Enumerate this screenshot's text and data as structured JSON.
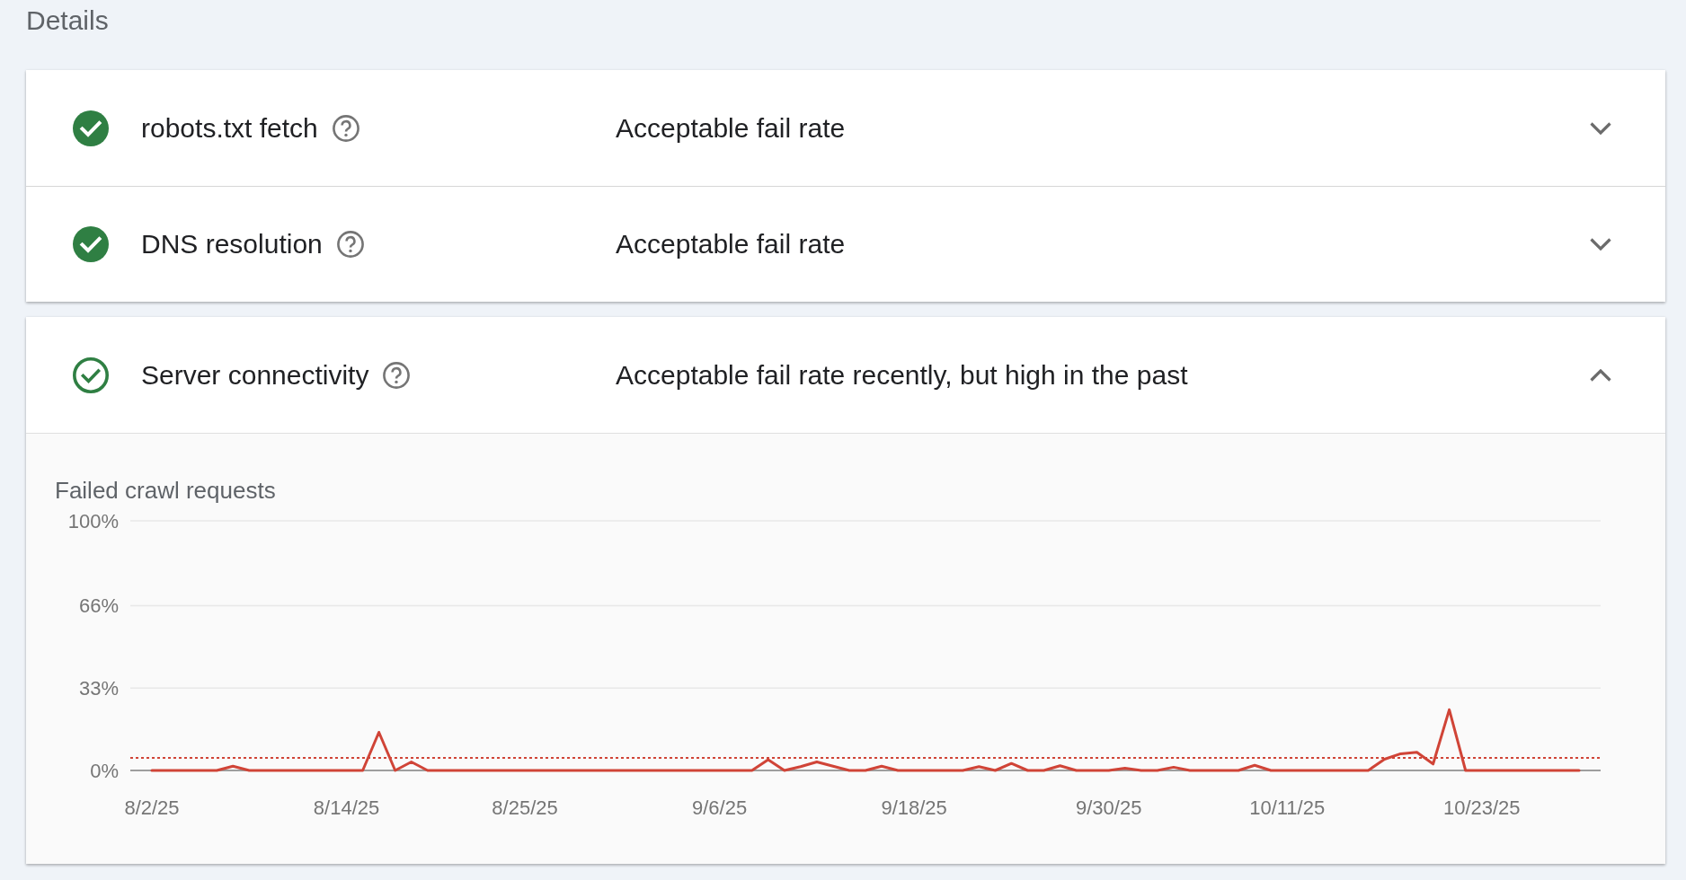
{
  "heading": "Details",
  "rows": [
    {
      "label": "robots.txt fetch",
      "status": "Acceptable fail rate",
      "kind": "filled",
      "expanded": false
    },
    {
      "label": "DNS resolution",
      "status": "Acceptable fail rate",
      "kind": "filled",
      "expanded": false
    },
    {
      "label": "Server connectivity",
      "status": "Acceptable fail rate recently, but high in the past",
      "kind": "outlined",
      "expanded": true,
      "chart_data": {
        "type": "line",
        "title": "Failed crawl requests",
        "categories": [
          "8/2/25",
          null,
          null,
          null,
          null,
          null,
          null,
          null,
          null,
          null,
          null,
          null,
          "8/14/25",
          null,
          null,
          null,
          null,
          null,
          null,
          null,
          null,
          null,
          null,
          "8/25/25",
          null,
          null,
          null,
          null,
          null,
          null,
          null,
          null,
          null,
          null,
          null,
          "9/6/25",
          null,
          null,
          null,
          null,
          null,
          null,
          null,
          null,
          null,
          null,
          null,
          "9/18/25",
          null,
          null,
          null,
          null,
          null,
          null,
          null,
          null,
          null,
          null,
          null,
          "9/30/25",
          null,
          null,
          null,
          null,
          null,
          null,
          null,
          null,
          null,
          null,
          "10/11/25",
          null,
          null,
          null,
          null,
          null,
          null,
          null,
          null,
          null,
          null,
          null,
          "10/23/25",
          null,
          null,
          null,
          null,
          null,
          null
        ],
        "series": [
          {
            "color": "#d04437",
            "values": [
              0,
              0,
              0,
              0,
              0,
              1.7,
              0,
              0,
              0,
              0,
              0,
              0,
              0,
              0,
              15.3,
              0,
              3.4,
              0,
              0,
              0,
              0,
              0,
              0,
              0,
              0,
              0,
              0,
              0,
              0,
              0,
              0,
              0,
              0,
              0,
              0,
              0,
              0,
              0,
              4.3,
              0,
              1.5,
              3.4,
              1.7,
              0,
              0,
              1.7,
              0,
              0,
              0,
              0,
              0,
              1.5,
              0,
              2.8,
              0,
              0,
              1.9,
              0,
              0,
              0,
              0.9,
              0,
              0,
              1.3,
              0,
              0,
              0,
              0,
              2.1,
              0,
              0,
              0,
              0,
              0,
              0,
              0,
              4.5,
              6.7,
              7.3,
              2.6,
              24.3,
              0,
              0,
              0,
              0,
              0,
              0,
              0,
              0
            ]
          }
        ],
        "ylim": [
          0,
          100
        ],
        "yticks": [
          {
            "value": 0,
            "label": "0%"
          },
          {
            "value": 33,
            "label": "33%"
          },
          {
            "value": 66,
            "label": "66%"
          },
          {
            "value": 100,
            "label": "100%"
          }
        ],
        "ref_lines": [
          {
            "axis": "y",
            "value": 5
          }
        ]
      }
    }
  ]
}
